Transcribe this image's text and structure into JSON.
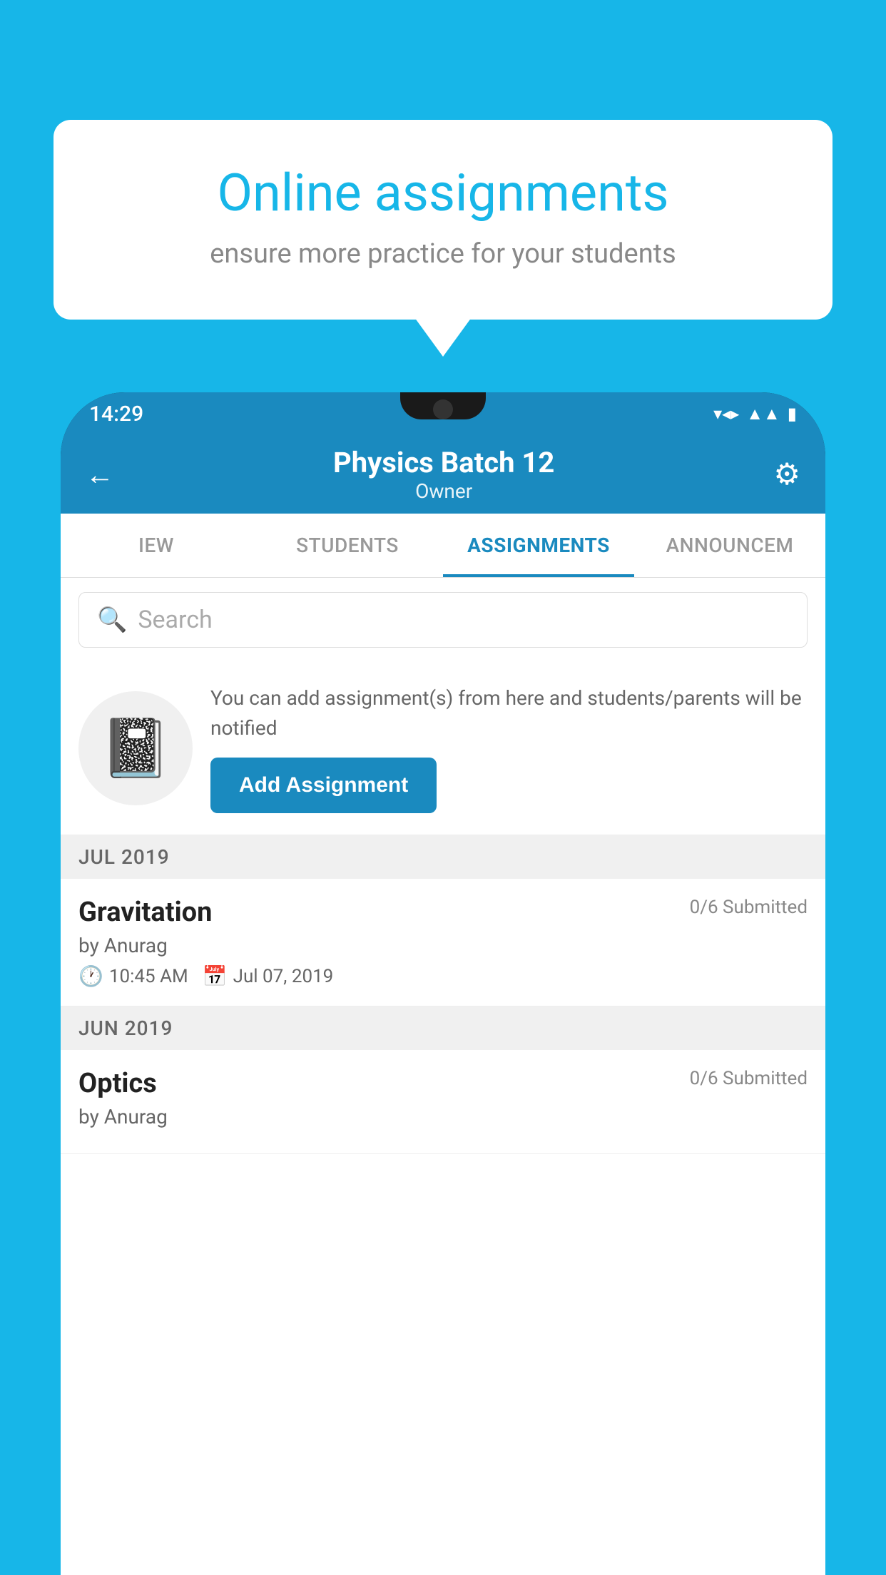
{
  "background_color": "#17b6e8",
  "speech_bubble": {
    "title": "Online assignments",
    "subtitle": "ensure more practice for your students"
  },
  "status_bar": {
    "time": "14:29",
    "icons": [
      "wifi",
      "signal",
      "battery"
    ]
  },
  "header": {
    "title": "Physics Batch 12",
    "subtitle": "Owner",
    "back_label": "←",
    "settings_label": "⚙"
  },
  "tabs": [
    {
      "label": "IEW",
      "active": false
    },
    {
      "label": "STUDENTS",
      "active": false
    },
    {
      "label": "ASSIGNMENTS",
      "active": true
    },
    {
      "label": "ANNOUNCEM",
      "active": false
    }
  ],
  "search": {
    "placeholder": "Search"
  },
  "promo": {
    "icon": "📓",
    "text": "You can add assignment(s) from here and students/parents will be notified",
    "button_label": "Add Assignment"
  },
  "sections": [
    {
      "label": "JUL 2019",
      "assignments": [
        {
          "name": "Gravitation",
          "submitted": "0/6 Submitted",
          "author": "by Anurag",
          "time": "10:45 AM",
          "date": "Jul 07, 2019"
        }
      ]
    },
    {
      "label": "JUN 2019",
      "assignments": [
        {
          "name": "Optics",
          "submitted": "0/6 Submitted",
          "author": "by Anurag",
          "time": "",
          "date": ""
        }
      ]
    }
  ]
}
